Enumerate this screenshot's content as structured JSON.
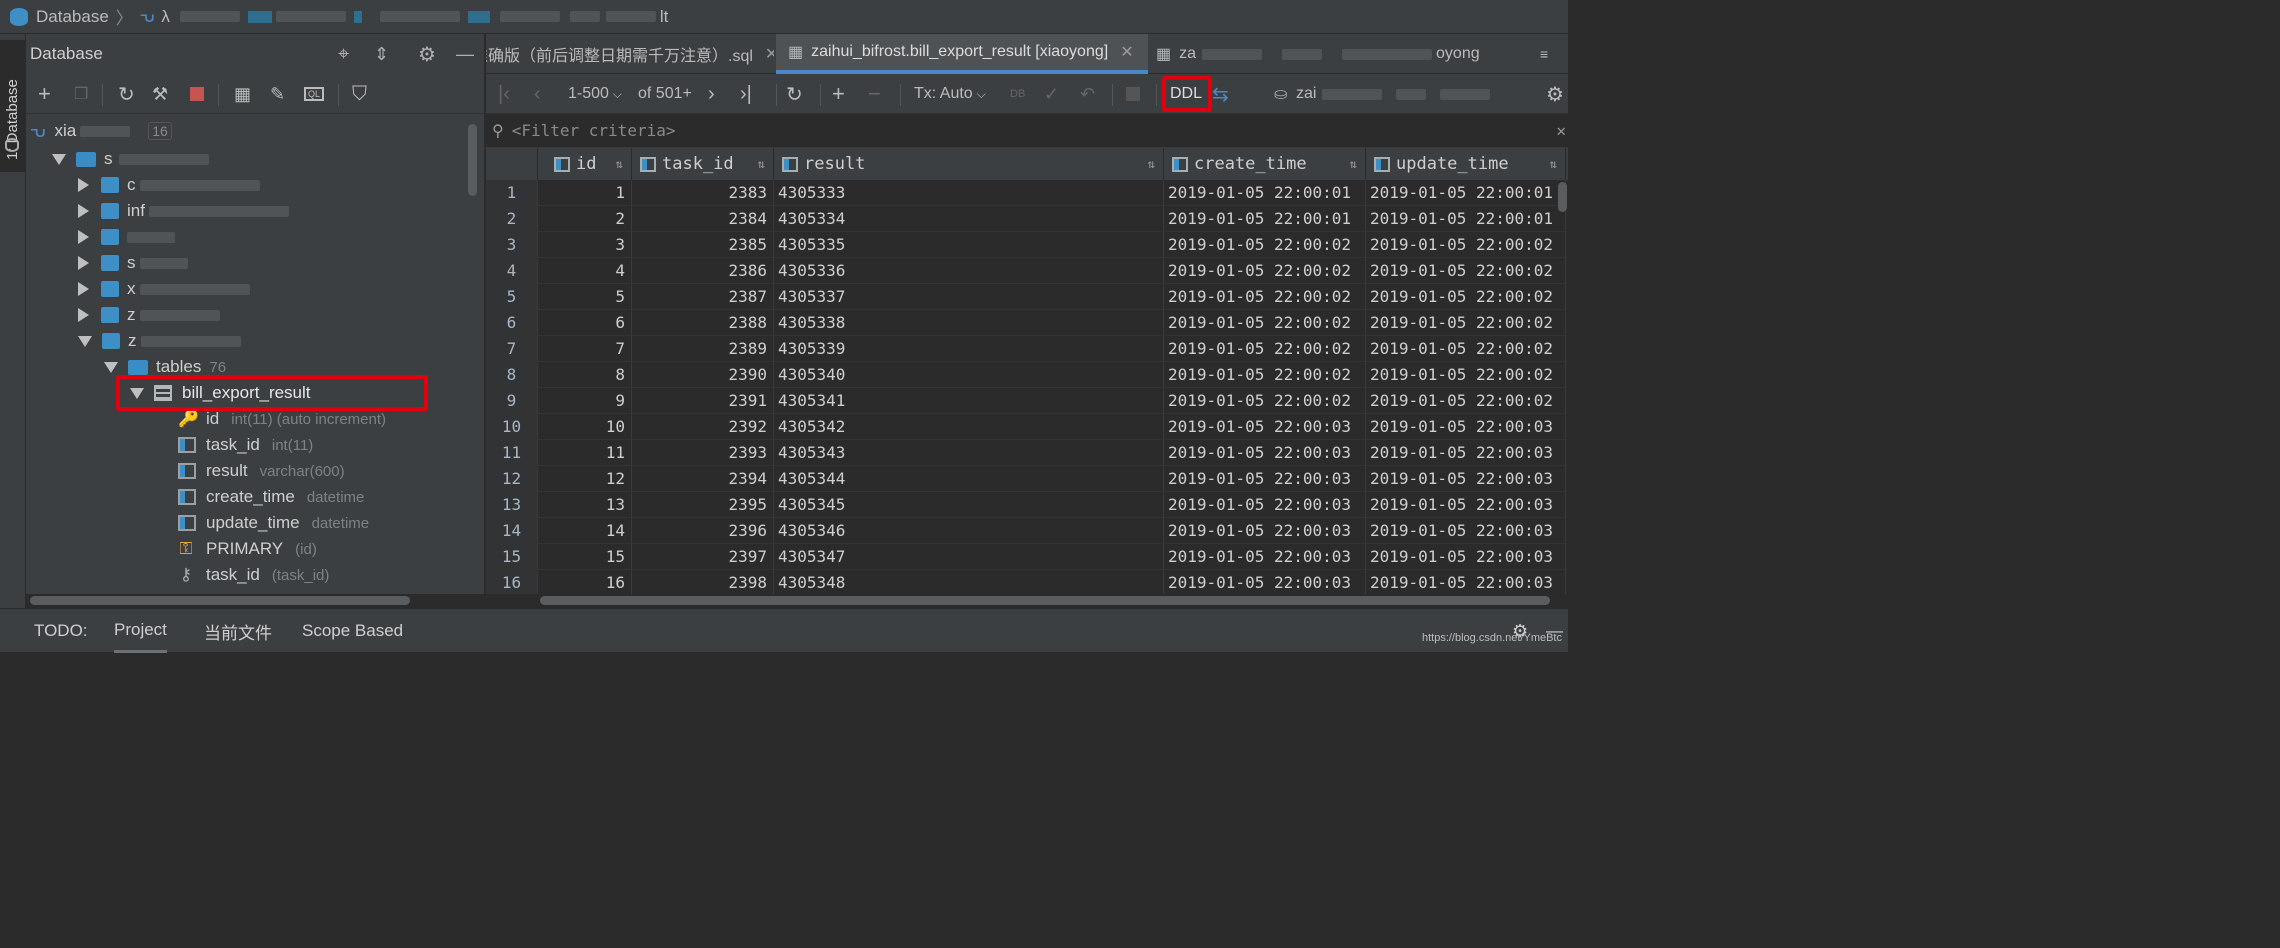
{
  "breadcrumb": {
    "root": "Database",
    "tail": "λ",
    "end": "lt"
  },
  "left_strip": {
    "tab_label": "1: Database"
  },
  "db_panel": {
    "title": "Database",
    "tree": {
      "connection": {
        "label": "xia",
        "badge": "16"
      },
      "schema": {
        "label": "s"
      },
      "databases": [
        "c",
        "inf",
        "",
        "s",
        "x",
        "z",
        "z"
      ],
      "tables_folder": {
        "label": "tables",
        "count": "76"
      },
      "selected_table": "bill_export_result",
      "columns": [
        {
          "name": "id",
          "type": "int(11) (auto increment)",
          "icon": "key-column-icon"
        },
        {
          "name": "task_id",
          "type": "int(11)",
          "icon": "column-icon"
        },
        {
          "name": "result",
          "type": "varchar(600)",
          "icon": "column-icon"
        },
        {
          "name": "create_time",
          "type": "datetime",
          "icon": "column-icon"
        },
        {
          "name": "update_time",
          "type": "datetime",
          "icon": "column-icon"
        }
      ],
      "keys": [
        {
          "name": "PRIMARY",
          "detail": "(id)",
          "icon": "primary-key-icon"
        },
        {
          "name": "task_id",
          "detail": "(task_id)",
          "icon": "index-icon"
        }
      ]
    }
  },
  "tabs": [
    {
      "label": "准确版（前后调整日期需千万注意）.sql",
      "active": false
    },
    {
      "label": "zaihui_bifrost.bill_export_result [xiaoyong]",
      "active": true
    },
    {
      "label": "za",
      "tail": "oyong",
      "active": false
    }
  ],
  "grid_toolbar": {
    "page_range": "1-500",
    "total": "of 501+",
    "tx_mode": "Tx: Auto",
    "ddl_label": "DDL",
    "connection": "zai"
  },
  "filter": {
    "placeholder": "<Filter criteria>"
  },
  "grid": {
    "columns": [
      "id",
      "task_id",
      "result",
      "create_time",
      "update_time"
    ],
    "rows": [
      [
        "1",
        "1",
        "2383",
        "4305333",
        "2019-01-05 22:00:01",
        "2019-01-05 22:00:01"
      ],
      [
        "2",
        "2",
        "2384",
        "4305334",
        "2019-01-05 22:00:01",
        "2019-01-05 22:00:01"
      ],
      [
        "3",
        "3",
        "2385",
        "4305335",
        "2019-01-05 22:00:02",
        "2019-01-05 22:00:02"
      ],
      [
        "4",
        "4",
        "2386",
        "4305336",
        "2019-01-05 22:00:02",
        "2019-01-05 22:00:02"
      ],
      [
        "5",
        "5",
        "2387",
        "4305337",
        "2019-01-05 22:00:02",
        "2019-01-05 22:00:02"
      ],
      [
        "6",
        "6",
        "2388",
        "4305338",
        "2019-01-05 22:00:02",
        "2019-01-05 22:00:02"
      ],
      [
        "7",
        "7",
        "2389",
        "4305339",
        "2019-01-05 22:00:02",
        "2019-01-05 22:00:02"
      ],
      [
        "8",
        "8",
        "2390",
        "4305340",
        "2019-01-05 22:00:02",
        "2019-01-05 22:00:02"
      ],
      [
        "9",
        "9",
        "2391",
        "4305341",
        "2019-01-05 22:00:02",
        "2019-01-05 22:00:02"
      ],
      [
        "10",
        "10",
        "2392",
        "4305342",
        "2019-01-05 22:00:03",
        "2019-01-05 22:00:03"
      ],
      [
        "11",
        "11",
        "2393",
        "4305343",
        "2019-01-05 22:00:03",
        "2019-01-05 22:00:03"
      ],
      [
        "12",
        "12",
        "2394",
        "4305344",
        "2019-01-05 22:00:03",
        "2019-01-05 22:00:03"
      ],
      [
        "13",
        "13",
        "2395",
        "4305345",
        "2019-01-05 22:00:03",
        "2019-01-05 22:00:03"
      ],
      [
        "14",
        "14",
        "2396",
        "4305346",
        "2019-01-05 22:00:03",
        "2019-01-05 22:00:03"
      ],
      [
        "15",
        "15",
        "2397",
        "4305347",
        "2019-01-05 22:00:03",
        "2019-01-05 22:00:03"
      ],
      [
        "16",
        "16",
        "2398",
        "4305348",
        "2019-01-05 22:00:03",
        "2019-01-05 22:00:03"
      ]
    ]
  },
  "bottom_bar": {
    "todo_label": "TODO:",
    "tabs": [
      "Project",
      "当前文件",
      "Scope Based"
    ]
  },
  "watermark": "https://blog.csdn.net/YmeBtc",
  "colors": {
    "accent": "#4a88c7",
    "highlight_box": "#e2000f",
    "selection": "#0d293e"
  }
}
